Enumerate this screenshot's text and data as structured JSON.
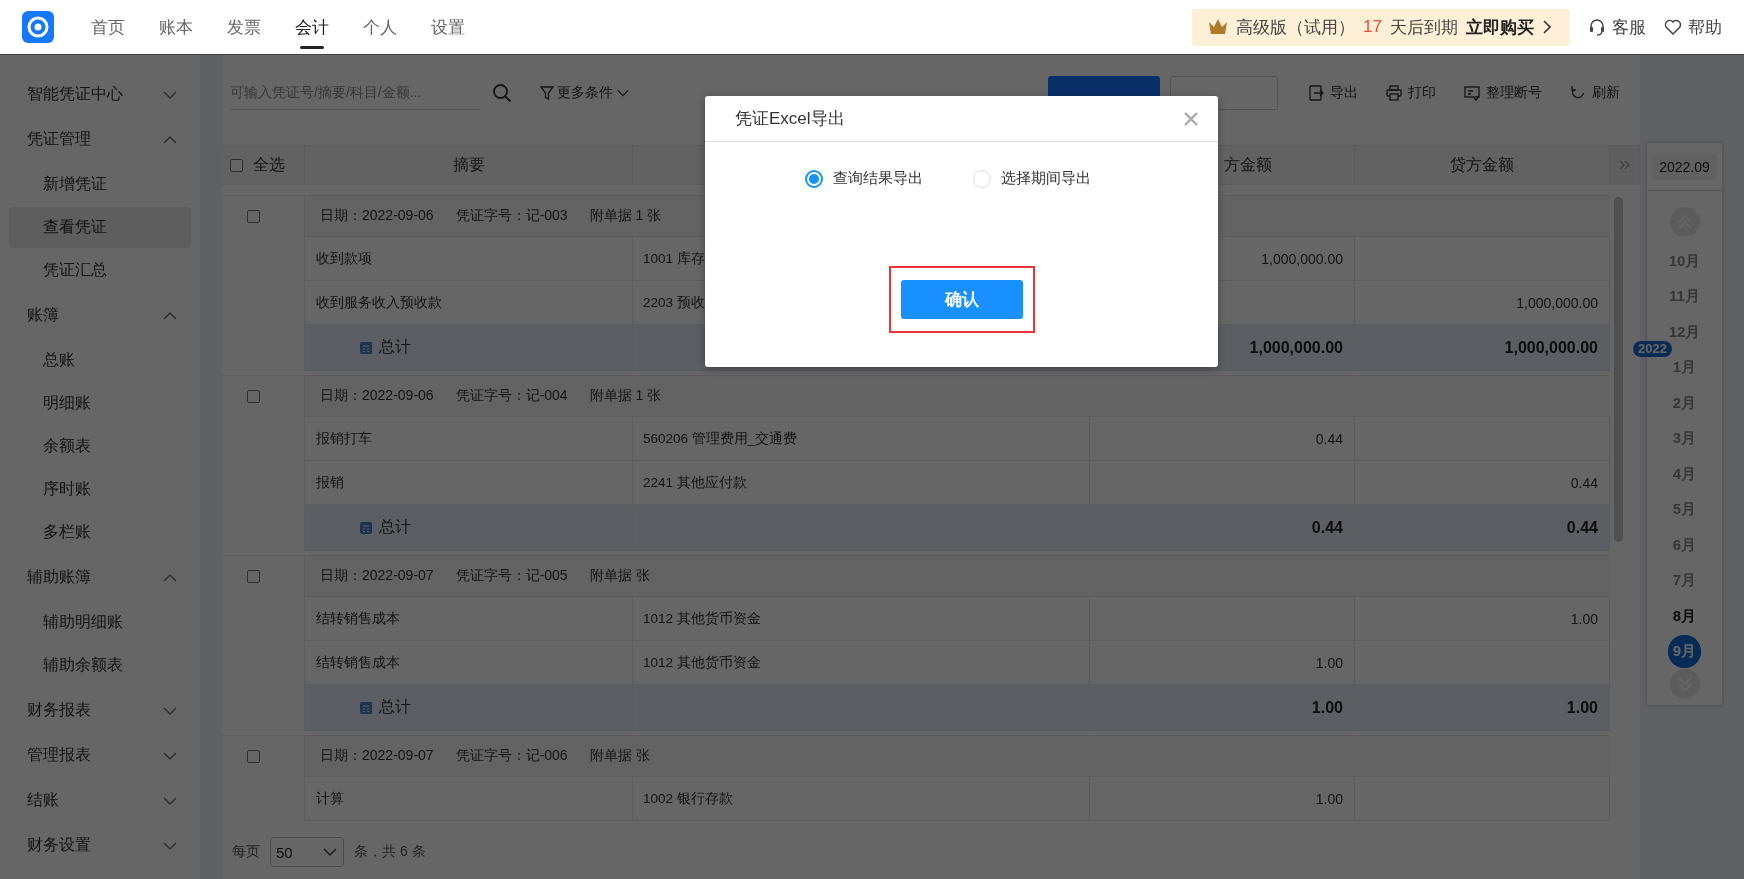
{
  "nav": {
    "tabs": [
      {
        "label": "首页",
        "selected": false
      },
      {
        "label": "账本",
        "selected": false
      },
      {
        "label": "发票",
        "selected": false
      },
      {
        "label": "会计",
        "selected": true
      },
      {
        "label": "个人",
        "selected": false
      },
      {
        "label": "设置",
        "selected": false
      }
    ]
  },
  "promo": {
    "plan": "高级版（试用）",
    "days": "17",
    "suffix": "天后到期",
    "action": "立即购买"
  },
  "links": [
    {
      "label": "客服",
      "kind": "support"
    },
    {
      "label": "帮助",
      "kind": "help"
    }
  ],
  "sidebar": {
    "items": [
      {
        "label": "智能凭证中心",
        "expanded": false
      },
      {
        "label": "凭证管理",
        "expanded": true,
        "children": [
          {
            "label": "新增凭证",
            "selected": false
          },
          {
            "label": "查看凭证",
            "selected": true
          },
          {
            "label": "凭证汇总",
            "selected": false
          }
        ]
      },
      {
        "label": "账簿",
        "expanded": true,
        "children": [
          {
            "label": "总账",
            "selected": false
          },
          {
            "label": "明细账",
            "selected": false
          },
          {
            "label": "余额表",
            "selected": false
          },
          {
            "label": "序时账",
            "selected": false
          },
          {
            "label": "多栏账",
            "selected": false
          }
        ]
      },
      {
        "label": "辅助账簿",
        "expanded": true,
        "children": [
          {
            "label": "辅助明细账",
            "selected": false
          },
          {
            "label": "辅助余额表",
            "selected": false
          }
        ]
      },
      {
        "label": "财务报表",
        "expanded": false
      },
      {
        "label": "管理报表",
        "expanded": false
      },
      {
        "label": "结账",
        "expanded": false
      },
      {
        "label": "财务设置",
        "expanded": false
      }
    ]
  },
  "toolbar": {
    "search": {
      "placeholder": "可输入凭证号/摘要/科目/金额..."
    },
    "filter": "更多条件",
    "actions": [
      {
        "label": "导出",
        "kind": "export"
      },
      {
        "label": "打印",
        "kind": "print"
      },
      {
        "label": "整理断号",
        "kind": "renumber"
      },
      {
        "label": "刷新",
        "kind": "refresh"
      }
    ]
  },
  "table": {
    "select_all": {
      "label": "全选",
      "checked": false
    },
    "header": {
      "summary": "摘要",
      "debit": "方金额",
      "credit": "贷方金额"
    },
    "vouchers": [
      {
        "checked": false,
        "date": "日期：2022-09-06",
        "number": "凭证字号：记-003",
        "attachments": "附单据 1 张",
        "entries": [
          {
            "summary": "收到款项",
            "account": "1001 库存",
            "debit": "1,000,000.00"
          },
          {
            "summary": "收到服务收入预收款",
            "account": "2203 预收",
            "credit": "1,000,000.00"
          }
        ],
        "total": {
          "label": "总计",
          "debit": "1,000,000.00",
          "credit": "1,000,000.00"
        }
      },
      {
        "checked": false,
        "date": "日期：2022-09-06",
        "number": "凭证字号：记-004",
        "attachments": "附单据 1 张",
        "entries": [
          {
            "summary": "报销打车",
            "account": "560206 管理费用_交通费",
            "debit": "0.44"
          },
          {
            "summary": "报销",
            "account": "2241 其他应付款",
            "credit": "0.44"
          }
        ],
        "total": {
          "label": "总计",
          "debit": "0.44",
          "credit": "0.44"
        }
      },
      {
        "checked": false,
        "date": "日期：2022-09-07",
        "number": "凭证字号：记-005",
        "attachments": "附单据 张",
        "entries": [
          {
            "summary": "结转销售成本",
            "account": "1012 其他货币资金",
            "credit": "1.00"
          },
          {
            "summary": "结转销售成本",
            "account": "1012 其他货币资金",
            "debit": "1.00"
          }
        ],
        "total": {
          "label": "总计",
          "debit": "1.00",
          "credit": "1.00"
        }
      },
      {
        "checked": false,
        "date": "日期：2022-09-07",
        "number": "凭证字号：记-006",
        "attachments": "附单据 张",
        "entries": [
          {
            "summary": "计算",
            "account": "1002 银行存款",
            "debit": "1.00"
          }
        ]
      }
    ]
  },
  "pager": {
    "label": "每页",
    "page_size": "50",
    "summary": "条，共 6 条"
  },
  "period_panel": {
    "current": "2022.09",
    "year_badge": "2022",
    "months": [
      {
        "label": "10月",
        "selected": false,
        "disabled": true
      },
      {
        "label": "11月",
        "selected": false,
        "disabled": true
      },
      {
        "label": "12月",
        "selected": false,
        "disabled": true
      },
      {
        "label": "1月",
        "selected": false,
        "disabled": true
      },
      {
        "label": "2月",
        "selected": false,
        "disabled": true
      },
      {
        "label": "3月",
        "selected": false,
        "disabled": true
      },
      {
        "label": "4月",
        "selected": false,
        "disabled": true
      },
      {
        "label": "5月",
        "selected": false,
        "disabled": true
      },
      {
        "label": "6月",
        "selected": false,
        "disabled": true
      },
      {
        "label": "7月",
        "selected": false,
        "disabled": true
      },
      {
        "label": "8月",
        "selected": false,
        "disabled": false
      },
      {
        "label": "9月",
        "selected": true,
        "disabled": false
      }
    ]
  },
  "dialog": {
    "title": "凭证Excel导出",
    "options": [
      {
        "label": "查询结果导出",
        "selected": true
      },
      {
        "label": "选择期间导出",
        "selected": false
      }
    ],
    "confirm": "确认",
    "confirm_highlighted": true
  }
}
